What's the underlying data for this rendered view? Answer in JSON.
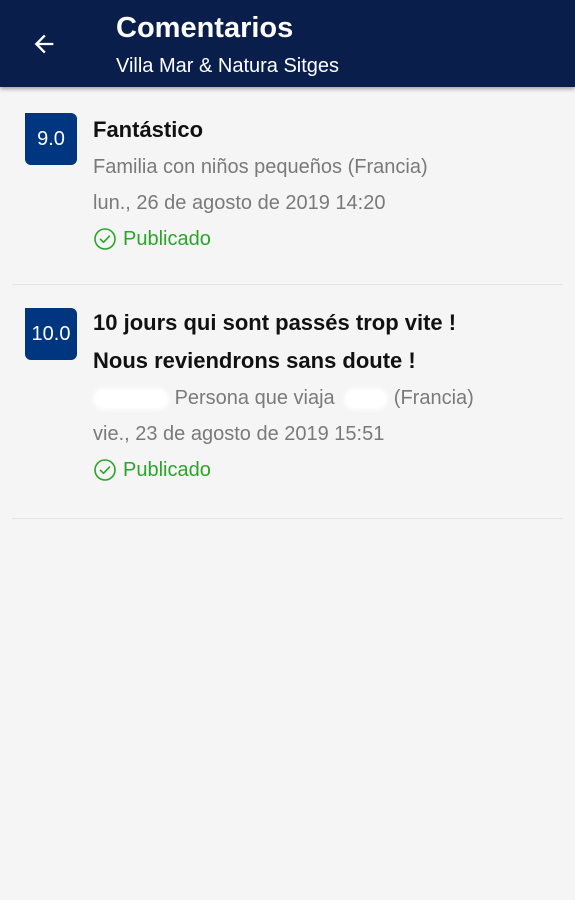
{
  "header": {
    "title": "Comentarios",
    "subtitle": "Villa Mar & Natura Sitges",
    "back_icon": "arrow-left-icon"
  },
  "reviews": [
    {
      "score": "9.0",
      "title": "Fantástico",
      "traveler": "Familia con niños pequeños (Francia)",
      "date": "lun., 26 de agosto de 2019 14:20",
      "status": "Publicado"
    },
    {
      "score": "10.0",
      "title_line1": "10 jours qui sont passés trop vite !",
      "title_line2": "Nous reviendrons sans doute !",
      "traveler_type": "Persona que viaja",
      "traveler_country": "(Francia)",
      "date": "vie., 23 de agosto de 2019 15:51",
      "status": "Publicado"
    }
  ],
  "colors": {
    "appbar": "#0a1e4b",
    "score_badge": "#003580",
    "published": "#2aa52a"
  }
}
